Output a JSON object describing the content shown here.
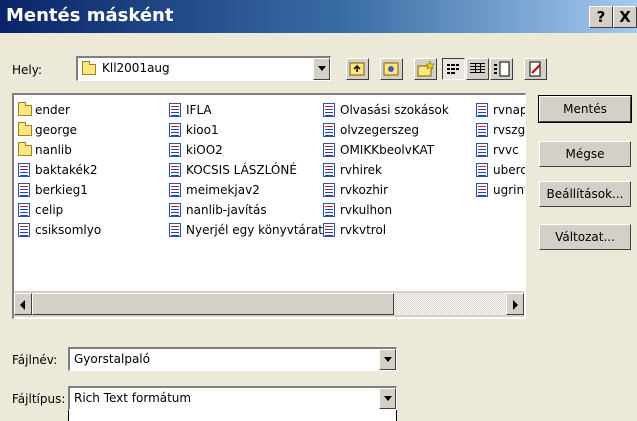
{
  "window": {
    "title": "Mentés másként",
    "help_label": "?",
    "close_label": "X"
  },
  "lookin": {
    "label": "Hely:",
    "value": "Kll2001aug"
  },
  "toolbar": {
    "buttons": [
      "up-folder-icon",
      "favorites-icon",
      "new-folder-icon",
      "list-view-icon",
      "details-view-icon",
      "properties-view-icon",
      "tools-icon"
    ]
  },
  "files": [
    {
      "name": "ender",
      "type": "folder"
    },
    {
      "name": "george",
      "type": "folder"
    },
    {
      "name": "nanlib",
      "type": "folder"
    },
    {
      "name": "baktakék2",
      "type": "doc"
    },
    {
      "name": "berkieg1",
      "type": "doc"
    },
    {
      "name": "celip",
      "type": "doc"
    },
    {
      "name": "csiksomlyo",
      "type": "doc"
    },
    {
      "name": "IFLA",
      "type": "doc"
    },
    {
      "name": "kioo1",
      "type": "doc"
    },
    {
      "name": "kiOO2",
      "type": "doc"
    },
    {
      "name": "KOCSIS LÁSZLÓNÉ",
      "type": "doc"
    },
    {
      "name": "meimekjav2",
      "type": "doc"
    },
    {
      "name": "nanlib-javítás",
      "type": "doc"
    },
    {
      "name": "Nyerjél egy könyvtárat",
      "type": "doc"
    },
    {
      "name": "Olvasási szokások",
      "type": "doc"
    },
    {
      "name": "olvzegerszeg",
      "type": "doc"
    },
    {
      "name": "OMIKKbeolvKAT",
      "type": "doc"
    },
    {
      "name": "rvhirek",
      "type": "doc"
    },
    {
      "name": "rvkozhir",
      "type": "doc"
    },
    {
      "name": "rvkulhon",
      "type": "doc"
    },
    {
      "name": "rvkvtrol",
      "type": "doc"
    },
    {
      "name": "rvnap",
      "type": "doc"
    },
    {
      "name": "rvszg",
      "type": "doc"
    },
    {
      "name": "rvvc",
      "type": "doc"
    },
    {
      "name": "uberd",
      "type": "doc"
    },
    {
      "name": "ugrint",
      "type": "doc"
    }
  ],
  "buttons": {
    "save": "Mentés",
    "cancel": "Mégse",
    "options": "Beállítások...",
    "versions": "Változat..."
  },
  "filename": {
    "label": "Fájlnév:",
    "value": "Gyorstalpaló"
  },
  "filetype": {
    "label": "Fájltípus:",
    "value": "Rich Text formátum"
  }
}
